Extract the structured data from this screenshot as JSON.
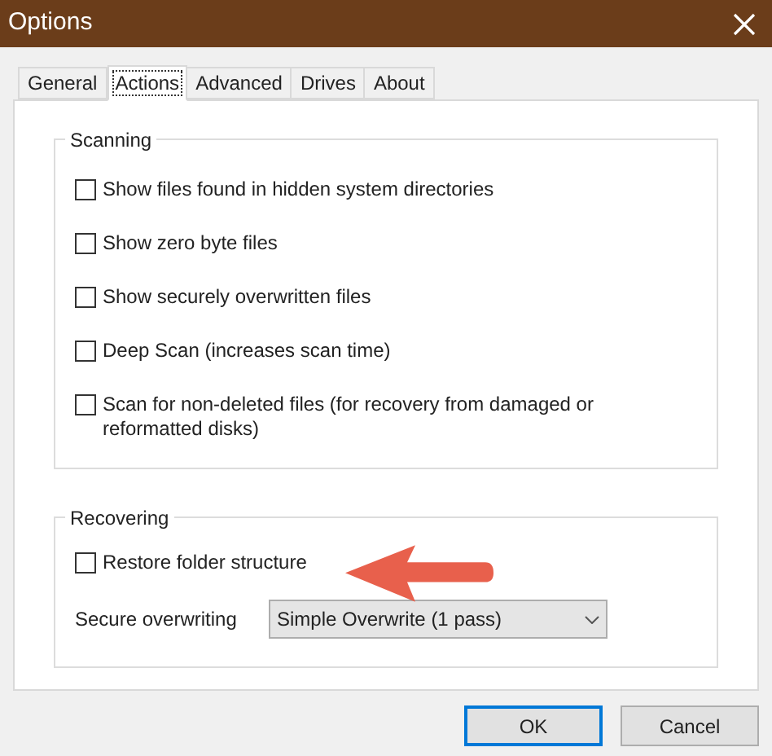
{
  "window": {
    "title": "Options"
  },
  "tabs": [
    {
      "label": "General",
      "selected": false
    },
    {
      "label": "Actions",
      "selected": true
    },
    {
      "label": "Advanced",
      "selected": false
    },
    {
      "label": "Drives",
      "selected": false
    },
    {
      "label": "About",
      "selected": false
    }
  ],
  "scanning": {
    "title": "Scanning",
    "options": [
      {
        "label": "Show files found in hidden system directories",
        "checked": false
      },
      {
        "label": "Show zero byte files",
        "checked": false
      },
      {
        "label": "Show securely overwritten files",
        "checked": false
      },
      {
        "label": "Deep Scan (increases scan time)",
        "checked": false
      },
      {
        "label": "Scan for non-deleted files (for recovery from damaged or reformatted disks)",
        "checked": false
      }
    ]
  },
  "recovering": {
    "title": "Recovering",
    "options": [
      {
        "label": "Restore folder structure",
        "checked": false
      }
    ],
    "secure_overwriting": {
      "label": "Secure overwriting",
      "value": "Simple Overwrite (1 pass)"
    }
  },
  "buttons": [
    {
      "label": "OK",
      "default": true
    },
    {
      "label": "Cancel",
      "default": false
    }
  ]
}
